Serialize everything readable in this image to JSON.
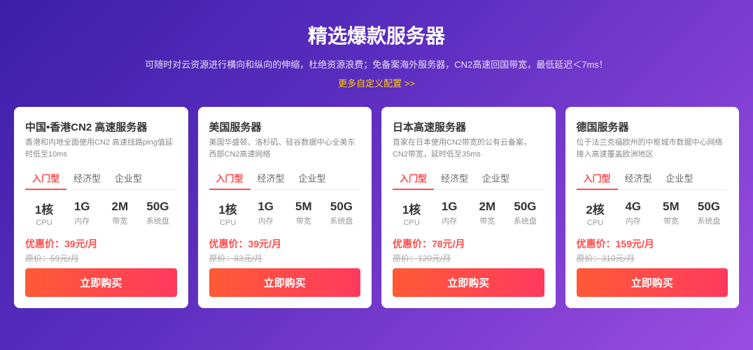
{
  "header": {
    "title": "精选爆款服务器",
    "subtitle": "可随时对云资源进行横向和纵向的伸缩，杜绝资源浪费；免备案海外服务器，CN2高速回国带宽，最低延迟＜7ms！",
    "more_link_text": "更多自定义配置 >>"
  },
  "cards": [
    {
      "id": "china-hk",
      "title": "中国•香港CN2 高速服务器",
      "desc": "香港和内地全面使用CN2 高速线路ping值延时低至10ms",
      "tabs": [
        "入门型",
        "经济型",
        "企业型"
      ],
      "active_tab": 0,
      "specs": [
        {
          "value": "1核",
          "label": "CPU"
        },
        {
          "value": "1G",
          "label": "内存"
        },
        {
          "value": "2M",
          "label": "带宽"
        },
        {
          "value": "50G",
          "label": "系统盘"
        }
      ],
      "discount_price": "优惠价：39元/月",
      "original_price": "原价：59元/月",
      "buy_label": "立即购买"
    },
    {
      "id": "usa",
      "title": "美国服务器",
      "desc": "美国华盛顿、洛杉矶、硅谷数据中心全美东西部CN2高速网络",
      "tabs": [
        "入门型",
        "经济型",
        "企业型"
      ],
      "active_tab": 0,
      "specs": [
        {
          "value": "1核",
          "label": "CPU"
        },
        {
          "value": "1G",
          "label": "内存"
        },
        {
          "value": "5M",
          "label": "带宽"
        },
        {
          "value": "50G",
          "label": "系统盘"
        }
      ],
      "discount_price": "优惠价：39元/月",
      "original_price": "原价：83元/月",
      "buy_label": "立即购买"
    },
    {
      "id": "japan",
      "title": "日本高速服务器",
      "desc": "首家在日本使用CN2带宽的公有云备案，CN2带宽，延时低至35ms",
      "tabs": [
        "入门型",
        "经济型",
        "企业型"
      ],
      "active_tab": 0,
      "specs": [
        {
          "value": "1核",
          "label": "CPU"
        },
        {
          "value": "1G",
          "label": "内存"
        },
        {
          "value": "2M",
          "label": "带宽"
        },
        {
          "value": "50G",
          "label": "系统盘"
        }
      ],
      "discount_price": "优惠价：78元/月",
      "original_price": "原价：120元/月",
      "buy_label": "立即购买"
    },
    {
      "id": "germany",
      "title": "德国服务器",
      "desc": "位于法兰克福欧州的中枢城市数据中心网络接入高速覆盖欧洲地区",
      "tabs": [
        "入门型",
        "经济型",
        "企业型"
      ],
      "active_tab": 0,
      "specs": [
        {
          "value": "2核",
          "label": "CPU"
        },
        {
          "value": "4G",
          "label": "内存"
        },
        {
          "value": "5M",
          "label": "带宽"
        },
        {
          "value": "50G",
          "label": "系统盘"
        }
      ],
      "discount_price": "优惠价：159元/月",
      "original_price": "原价：310元/月",
      "buy_label": "立即购买"
    }
  ]
}
